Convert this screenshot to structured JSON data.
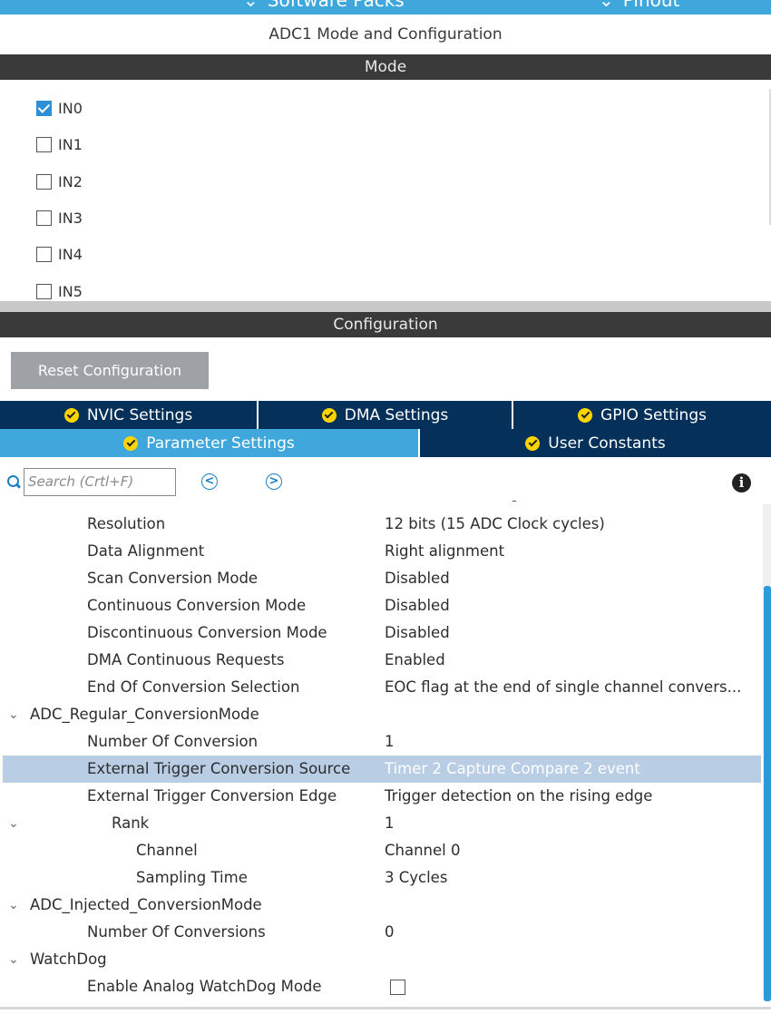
{
  "top_bar": {
    "software_packs": "Software Packs",
    "pinout": "Pinout"
  },
  "title": "ADC1 Mode and Configuration",
  "mode": {
    "header": "Mode",
    "channels": [
      {
        "label": "IN0",
        "checked": true
      },
      {
        "label": "IN1",
        "checked": false
      },
      {
        "label": "IN2",
        "checked": false
      },
      {
        "label": "IN3",
        "checked": false
      },
      {
        "label": "IN4",
        "checked": false
      },
      {
        "label": "IN5",
        "checked": false
      }
    ]
  },
  "configuration": {
    "header": "Configuration",
    "reset_button": "Reset Configuration",
    "tabs_row1": [
      "NVIC Settings",
      "DMA Settings",
      "GPIO Settings"
    ],
    "tabs_row2": [
      "Parameter Settings",
      "User Constants"
    ],
    "active_tab": "Parameter Settings",
    "search": {
      "placeholder": "Search (Crtl+F)",
      "prev": "<",
      "next": ">"
    },
    "params": [
      {
        "name": "Resolution",
        "value": "12 bits (15 ADC Clock cycles)"
      },
      {
        "name": "Data Alignment",
        "value": "Right alignment"
      },
      {
        "name": "Scan Conversion Mode",
        "value": "Disabled"
      },
      {
        "name": "Continuous Conversion Mode",
        "value": "Disabled"
      },
      {
        "name": "Discontinuous Conversion Mode",
        "value": "Disabled"
      },
      {
        "name": "DMA Continuous Requests",
        "value": "Enabled"
      },
      {
        "name": "End Of Conversion Selection",
        "value": "EOC flag at the end of single channel convers..."
      },
      {
        "name": "ADC_Regular_ConversionMode",
        "value": ""
      },
      {
        "name": "Number Of Conversion",
        "value": "1"
      },
      {
        "name": "External Trigger Conversion Source",
        "value": "Timer 2 Capture Compare 2 event"
      },
      {
        "name": "External Trigger Conversion Edge",
        "value": "Trigger detection on the rising edge"
      },
      {
        "name": "Rank",
        "value": "1"
      },
      {
        "name": "Channel",
        "value": "Channel 0"
      },
      {
        "name": "Sampling Time",
        "value": "3 Cycles"
      },
      {
        "name": "ADC_Injected_ConversionMode",
        "value": ""
      },
      {
        "name": "Number Of Conversions",
        "value": "0"
      },
      {
        "name": "WatchDog",
        "value": ""
      },
      {
        "name": "Enable Analog WatchDog Mode",
        "value": "",
        "checkbox": false
      }
    ],
    "selected_param": "External Trigger Conversion Source"
  },
  "colors": {
    "accent_blue": "#3fa7dc",
    "tab_dark": "#04305a",
    "band_dark": "#3a3a3a",
    "selected_row": "#b9cde4",
    "ok_yellow": "#ffd500"
  }
}
